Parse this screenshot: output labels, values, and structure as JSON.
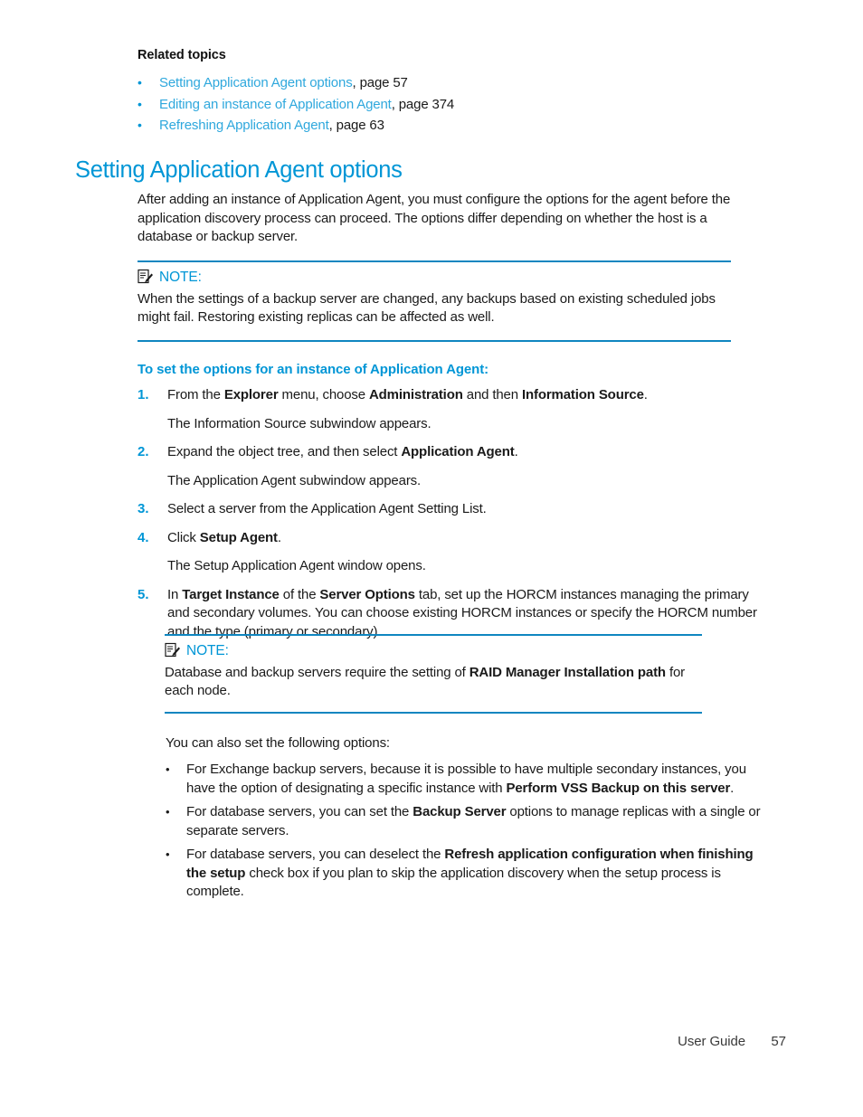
{
  "related": {
    "heading": "Related topics",
    "bullet_glyph": "•",
    "items": [
      {
        "link": "Setting Application Agent options",
        "tail": ", page 57"
      },
      {
        "link": "Editing an instance of Application Agent",
        "tail": ", page 374"
      },
      {
        "link": "Refreshing Application Agent",
        "tail": ", page 63"
      }
    ]
  },
  "section": {
    "heading": "Setting Application Agent options",
    "intro": "After adding an instance of Application Agent, you must configure the options for the agent before the application discovery process can proceed. The options differ depending on whether the host is a database or backup server."
  },
  "note1": {
    "icon": "note-pencil-icon",
    "label": "NOTE:",
    "body": "When the settings of a backup server are changed, any backups based on existing scheduled jobs might fail. Restoring existing replicas can be affected as well."
  },
  "procedure": {
    "heading": "To set the options for an instance of Application Agent:",
    "steps": [
      {
        "num": "1.",
        "parts": [
          {
            "t": "From the ",
            "b": false
          },
          {
            "t": "Explorer",
            "b": true
          },
          {
            "t": " menu, choose ",
            "b": false
          },
          {
            "t": "Administration",
            "b": true
          },
          {
            "t": " and then ",
            "b": false
          },
          {
            "t": "Information Source",
            "b": true
          },
          {
            "t": ".",
            "b": false
          }
        ],
        "result": "The Information Source subwindow appears."
      },
      {
        "num": "2.",
        "parts": [
          {
            "t": "Expand the object tree, and then select ",
            "b": false
          },
          {
            "t": "Application Agent",
            "b": true
          },
          {
            "t": ".",
            "b": false
          }
        ],
        "result": "The Application Agent subwindow appears."
      },
      {
        "num": "3.",
        "parts": [
          {
            "t": "Select a server from the Application Agent Setting List.",
            "b": false
          }
        ],
        "result": ""
      },
      {
        "num": "4.",
        "parts": [
          {
            "t": "Click ",
            "b": false
          },
          {
            "t": "Setup Agent",
            "b": true
          },
          {
            "t": ".",
            "b": false
          }
        ],
        "result": "The Setup Application Agent window opens."
      },
      {
        "num": "5.",
        "parts": [
          {
            "t": "In ",
            "b": false
          },
          {
            "t": "Target Instance",
            "b": true
          },
          {
            "t": " of the ",
            "b": false
          },
          {
            "t": "Server Options",
            "b": true
          },
          {
            "t": " tab, set up the HORCM instances managing the primary and secondary volumes. You can choose existing HORCM instances or specify the HORCM number and the type (primary or secondary).",
            "b": false
          }
        ],
        "result": ""
      }
    ]
  },
  "note2": {
    "icon": "note-pencil-icon",
    "label": "NOTE:",
    "body_parts": [
      {
        "t": "Database and backup servers require the setting of  ",
        "b": false
      },
      {
        "t": "RAID Manager Installation path",
        "b": true
      },
      {
        "t": " for each node.",
        "b": false
      }
    ]
  },
  "options": {
    "intro": "You can also set the following options:",
    "bullet_glyph": "•",
    "items": [
      [
        {
          "t": "For Exchange backup servers, because it is possible to have multiple secondary instances, you have the option of designating a specific instance with ",
          "b": false
        },
        {
          "t": "Perform VSS Backup on this server",
          "b": true
        },
        {
          "t": ".",
          "b": false
        }
      ],
      [
        {
          "t": "For database servers, you can set the ",
          "b": false
        },
        {
          "t": "Backup Server",
          "b": true
        },
        {
          "t": " options to manage replicas with a single or separate servers.",
          "b": false
        }
      ],
      [
        {
          "t": "For database servers, you can deselect the ",
          "b": false
        },
        {
          "t": "Refresh application configuration when finishing the setup",
          "b": true
        },
        {
          "t": " check box if you plan to skip the application discovery when the setup process is complete.",
          "b": false
        }
      ]
    ]
  },
  "footer": {
    "guide_label": "User Guide",
    "page_number": "57"
  },
  "colors": {
    "accent_blue": "#0096d6",
    "link_blue": "#2fa8dd",
    "rule_blue": "#0f86c0",
    "text_black": "#1a1a1a"
  }
}
